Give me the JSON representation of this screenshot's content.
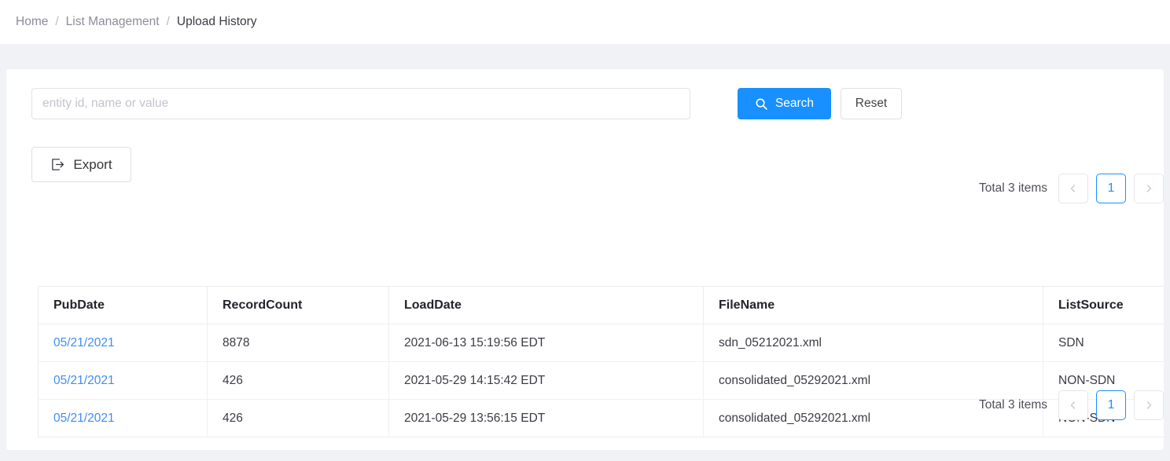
{
  "breadcrumb": {
    "items": [
      {
        "label": "Home",
        "current": false
      },
      {
        "label": "List Management",
        "current": false
      },
      {
        "label": "Upload History",
        "current": true
      }
    ],
    "separator": "/"
  },
  "search": {
    "placeholder": "entity id, name or value",
    "value": "",
    "search_label": "Search",
    "search_icon": "search-icon",
    "reset_label": "Reset"
  },
  "toolbar": {
    "export_label": "Export",
    "export_icon": "export-icon"
  },
  "pagination": {
    "total_label": "Total 3 items",
    "prev_icon": "chevron-left-icon",
    "next_icon": "chevron-right-icon",
    "current_page": "1",
    "active_color": "#1890ff"
  },
  "table": {
    "columns": [
      {
        "key": "pubdate",
        "label": "PubDate"
      },
      {
        "key": "record",
        "label": "RecordCount"
      },
      {
        "key": "loaddate",
        "label": "LoadDate"
      },
      {
        "key": "filename",
        "label": "FileName"
      },
      {
        "key": "listsource",
        "label": "ListSource"
      }
    ],
    "rows": [
      {
        "pubdate": "05/21/2021",
        "record": "8878",
        "loaddate": "2021-06-13 15:19:56 EDT",
        "filename": "sdn_05212021.xml",
        "listsource": "SDN"
      },
      {
        "pubdate": "05/21/2021",
        "record": "426",
        "loaddate": "2021-05-29 14:15:42 EDT",
        "filename": "consolidated_05292021.xml",
        "listsource": "NON-SDN"
      },
      {
        "pubdate": "05/21/2021",
        "record": "426",
        "loaddate": "2021-05-29 13:56:15 EDT",
        "filename": "consolidated_05292021.xml",
        "listsource": "NON-SDN"
      }
    ]
  },
  "theme": {
    "primary": "#1890ff",
    "link": "#3d8ef7",
    "page_background": "#f0f2f5",
    "card_background": "#ffffff"
  }
}
